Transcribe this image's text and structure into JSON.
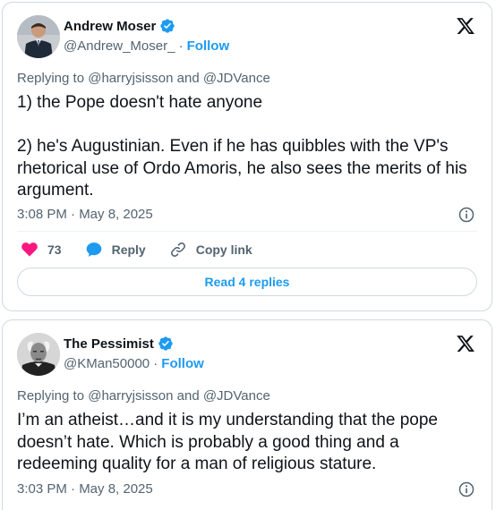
{
  "tweets": [
    {
      "name": "Andrew Moser",
      "handle": "@Andrew_Moser_",
      "follow_label": "Follow",
      "replying_prefix": "Replying to ",
      "replying_to": "@harryjsisson and @JDVance",
      "text": "1) the Pope doesn't hate anyone\n\n2) he's Augustinian. Even if he has quibbles with the VP's rhetorical use of Ordo Amoris, he also sees the merits of his argument.",
      "timestamp": "3:08 PM · May 8, 2025",
      "likes": "73",
      "reply_label": "Reply",
      "copy_link_label": "Copy link",
      "read_replies_label": "Read 4 replies"
    },
    {
      "name": "The Pessimist",
      "handle": "@KMan50000",
      "follow_label": "Follow",
      "replying_prefix": "Replying to ",
      "replying_to": "@harryjsisson and @JDVance",
      "text": "I’m an atheist…and it is my understanding that the pope doesn’t hate. Which is probably a good thing and a redeeming quality for a man of religious stature.",
      "timestamp": "3:03 PM · May 8, 2025"
    }
  ],
  "icons": {
    "verified": "verified-badge-icon",
    "x_logo": "x-logo-icon",
    "info": "info-icon",
    "like": "heart-icon",
    "reply": "speech-bubble-icon",
    "copy_link": "link-icon"
  },
  "colors": {
    "accent": "#1d9bf0",
    "like": "#f91880",
    "muted": "#536471",
    "text": "#0f1419",
    "border": "#cfd9de"
  }
}
